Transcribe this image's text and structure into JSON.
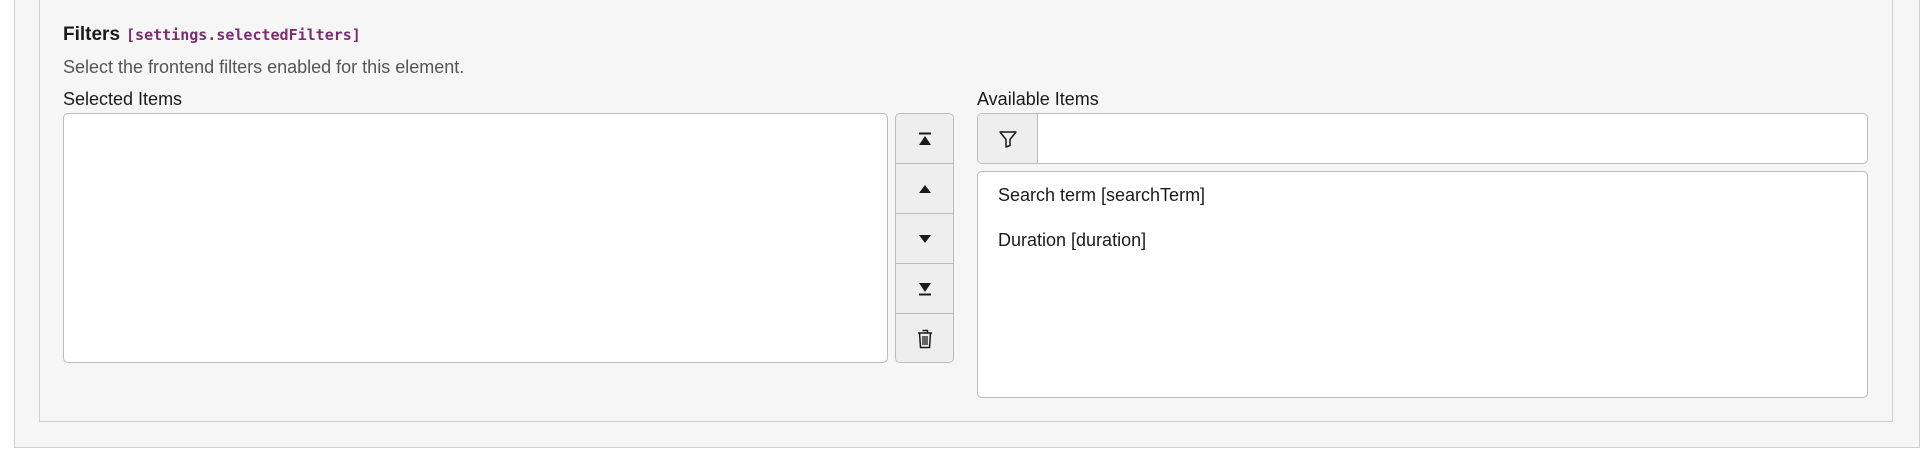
{
  "field": {
    "title": "Filters",
    "code": "[settings.selectedFilters]",
    "description": "Select the frontend filters enabled for this element."
  },
  "selected": {
    "label": "Selected Items",
    "items": []
  },
  "available": {
    "label": "Available Items",
    "filter_value": "",
    "items": [
      "Search term [searchTerm]",
      "Duration [duration]"
    ]
  },
  "buttons": {
    "move_top_icon": "move-to-top-icon",
    "move_up_icon": "move-up-icon",
    "move_down_icon": "move-down-icon",
    "move_bottom_icon": "move-to-bottom-icon",
    "remove_icon": "trash-icon",
    "filter_icon": "funnel-icon"
  },
  "colors": {
    "code_accent": "#7b2d6e",
    "panel_bg": "#f6f6f6",
    "border": "#bbbbbb"
  }
}
